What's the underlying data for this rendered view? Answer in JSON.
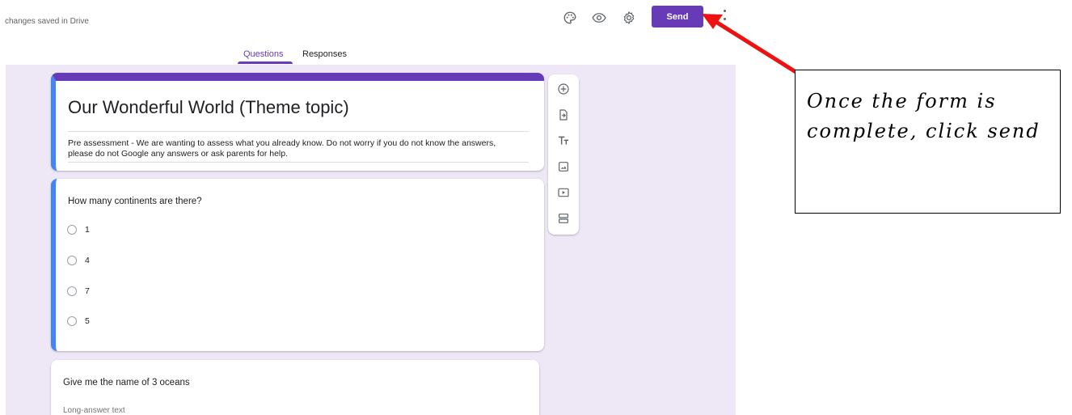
{
  "header": {
    "save_status": "changes saved in Drive",
    "send_label": "Send",
    "icons": [
      "palette-icon",
      "eye-icon",
      "gear-icon",
      "more-vert-icon"
    ],
    "accent_color": "#673ab7"
  },
  "tabs": [
    {
      "label": "Questions",
      "active": true
    },
    {
      "label": "Responses",
      "active": false
    }
  ],
  "form": {
    "title": "Our Wonderful World (Theme topic)",
    "description": "Pre assessment - We are wanting to assess what you already know.  Do not worry if you do not know the answers, please do not Google any answers or ask parents for help.",
    "questions": [
      {
        "text": "How many continents are there?",
        "type": "multiple-choice",
        "options": [
          "1",
          "4",
          "7",
          "5"
        ]
      },
      {
        "text": "Give me the name of 3 oceans",
        "type": "paragraph",
        "placeholder": "Long-answer text"
      }
    ]
  },
  "side_toolbar": [
    "add-question-icon",
    "import-questions-icon",
    "add-title-icon",
    "add-image-icon",
    "add-video-icon",
    "add-section-icon"
  ],
  "annotation": {
    "text": "Once the form is complete, click send",
    "arrow_color": "#ee1111"
  }
}
